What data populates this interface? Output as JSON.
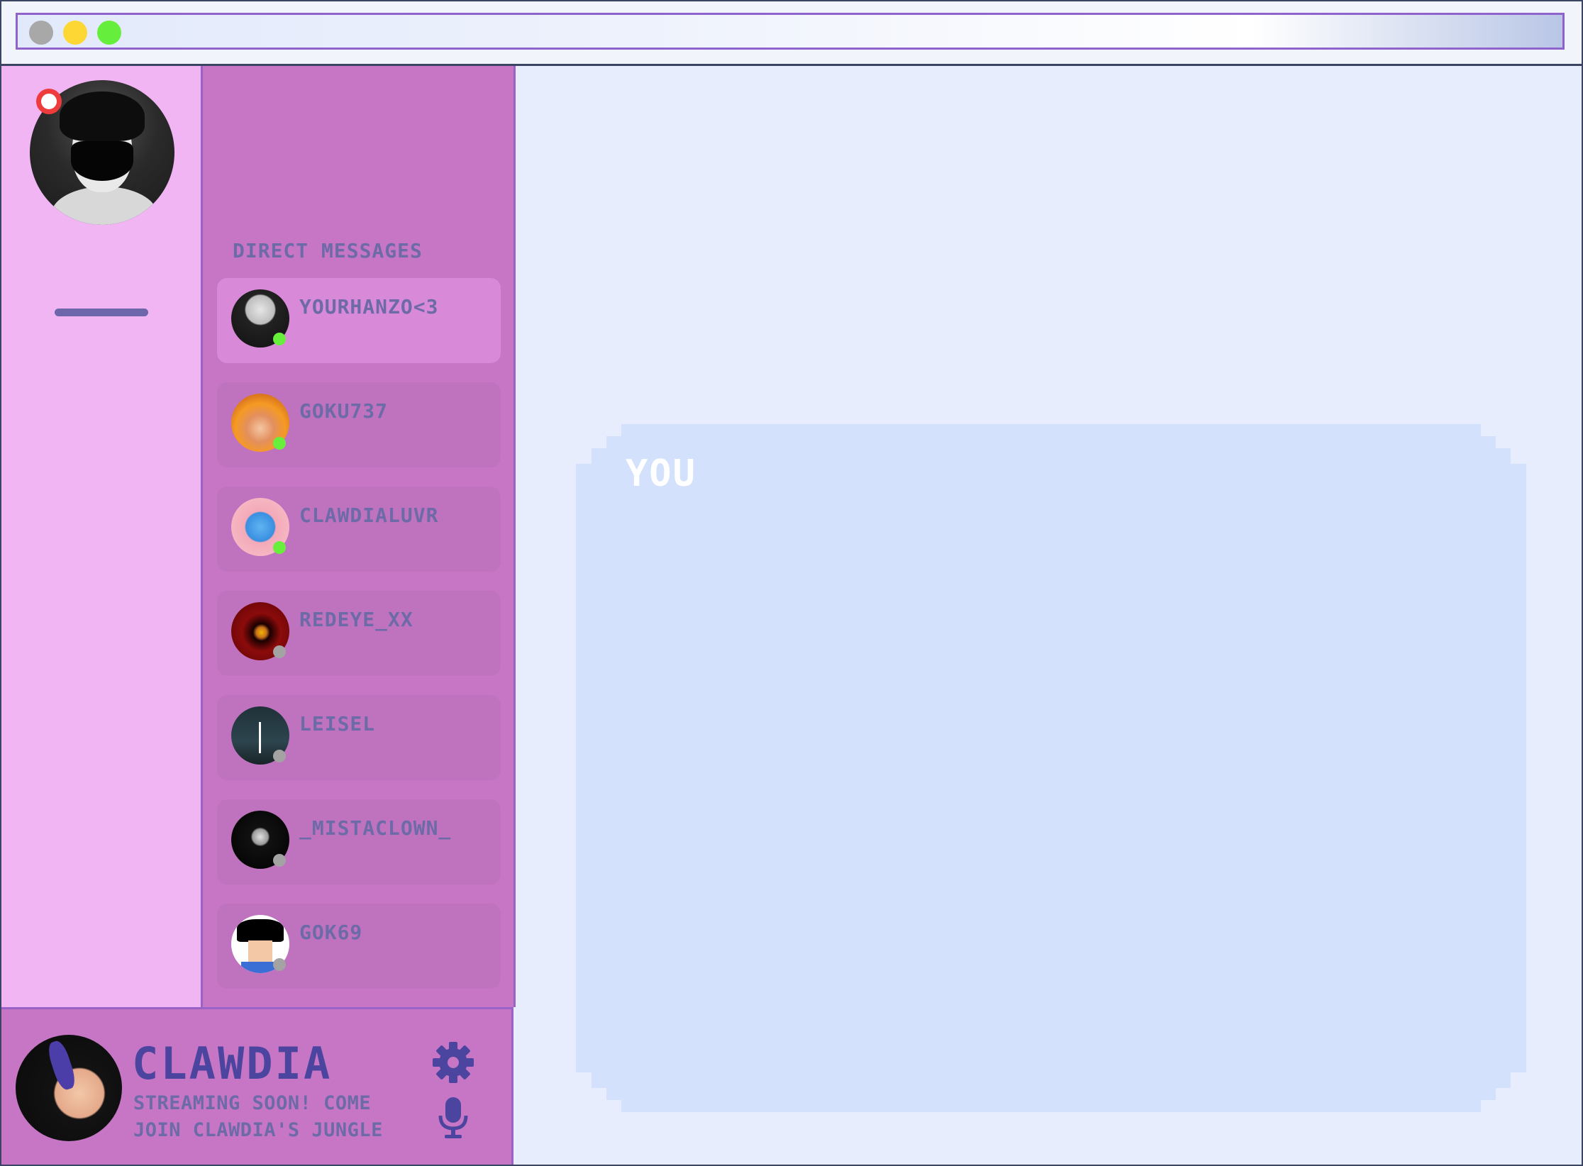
{
  "window": {
    "controls": [
      "close",
      "minimize",
      "maximize"
    ]
  },
  "servers": {
    "notification": "unread"
  },
  "dms": {
    "header": "DIRECT MESSAGES",
    "items": [
      {
        "name": "YOURHANZO<3",
        "status": "online",
        "active": true
      },
      {
        "name": "GOKU737",
        "status": "online",
        "active": false
      },
      {
        "name": "CLAWDIALUVR",
        "status": "online",
        "active": false
      },
      {
        "name": "REDEYE_XX",
        "status": "offline",
        "active": false
      },
      {
        "name": "LEISEL",
        "status": "offline",
        "active": false
      },
      {
        "name": "_MISTACLOWN_",
        "status": "offline",
        "active": false
      },
      {
        "name": "GOK69",
        "status": "offline",
        "active": false
      }
    ]
  },
  "profile": {
    "name": "CLAWDIA",
    "status": "STREAMING SOON! COME JOIN CLAWDIA'S JUNGLE"
  },
  "chat": {
    "label": "YOU"
  },
  "icons": [
    "gear-icon",
    "microphone-icon"
  ],
  "colors": {
    "online": "#67ef3b",
    "offline": "#a3a3a3",
    "accent": "#4b45a0",
    "sidebar": "#c676c5",
    "server_bar": "#f1b5f3",
    "chat_bg": "#e8edfd",
    "chat_panel": "#d4e1fc"
  }
}
